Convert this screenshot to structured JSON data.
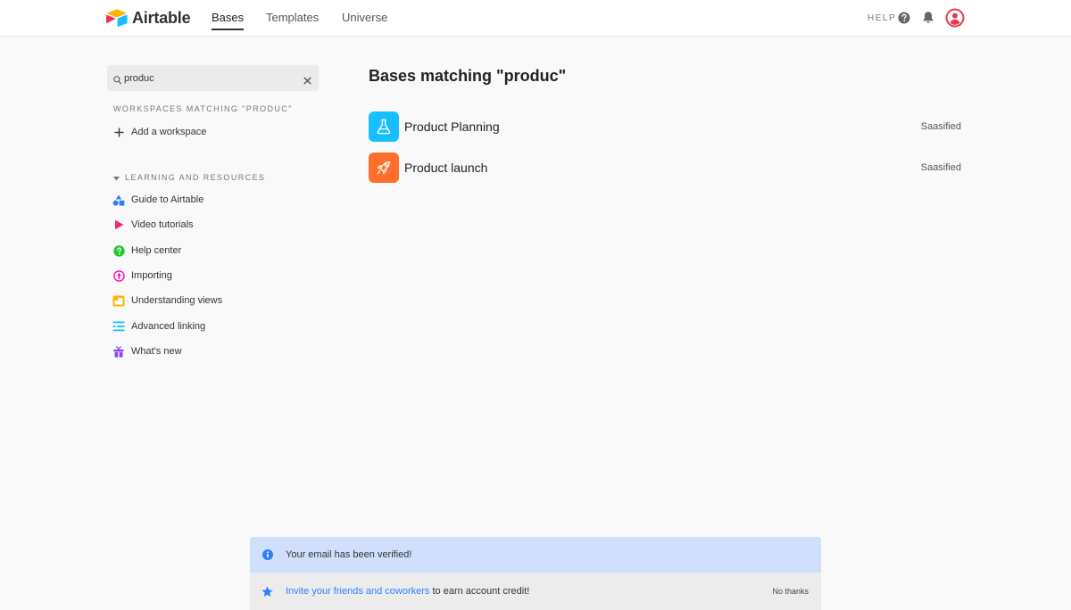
{
  "header": {
    "logo_text": "Airtable",
    "tabs": [
      {
        "label": "Bases",
        "active": true
      },
      {
        "label": "Templates",
        "active": false
      },
      {
        "label": "Universe",
        "active": false
      }
    ],
    "help_label": "HELP"
  },
  "sidebar": {
    "search": {
      "value": "produc",
      "placeholder": ""
    },
    "workspaces_label": "WORKSPACES MATCHING \"PRODUC\"",
    "add_workspace_label": "Add a workspace",
    "resources_label": "LEARNING AND RESOURCES",
    "resources": [
      {
        "label": "Guide to Airtable",
        "icon": "shapes-icon",
        "color": "#2d7ff9"
      },
      {
        "label": "Video tutorials",
        "icon": "play-icon",
        "color": "#f82b60"
      },
      {
        "label": "Help center",
        "icon": "question-circle-icon",
        "color": "#20c933"
      },
      {
        "label": "Importing",
        "icon": "upload-circle-icon",
        "color": "#ff08c2"
      },
      {
        "label": "Understanding views",
        "icon": "views-icon",
        "color": "#fcb400"
      },
      {
        "label": "Advanced linking",
        "icon": "linking-icon",
        "color": "#18bfff"
      },
      {
        "label": "What's new",
        "icon": "gift-icon",
        "color": "#8b46ff"
      }
    ]
  },
  "main": {
    "title": "Bases matching \"produc\"",
    "bases": [
      {
        "name": "Product Planning",
        "workspace": "Saasified",
        "icon": "flask-icon",
        "color": "#18bfff"
      },
      {
        "name": "Product launch",
        "workspace": "Saasified",
        "icon": "rocket-icon",
        "color": "#ff6f2c"
      }
    ]
  },
  "banners": {
    "verified_text": "Your email has been verified!",
    "invite_link": "Invite your friends and coworkers",
    "invite_rest": " to earn account credit!",
    "no_thanks": "No thanks"
  },
  "colors": {
    "accent_blue": "#2d7ff9",
    "avatar_red": "#e8384f",
    "verified_bg": "#d0e0fc"
  }
}
